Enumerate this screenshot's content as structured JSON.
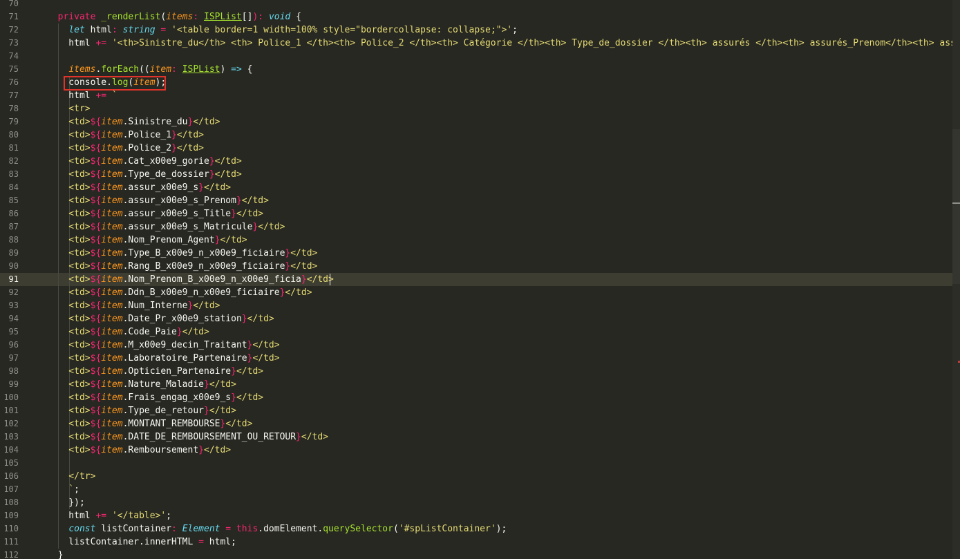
{
  "editor": {
    "active_line": 91,
    "lines": [
      {
        "n": 70,
        "tokens": []
      },
      {
        "n": 71,
        "tokens": [
          [
            "kw",
            "  private "
          ],
          [
            "fn",
            "_renderList"
          ],
          [
            "pl",
            "("
          ],
          [
            "pa",
            "items"
          ],
          [
            "kw",
            ": "
          ],
          [
            "tp",
            "ISPList"
          ],
          [
            "pl",
            "[]"
          ],
          [
            "kw",
            ")"
          ],
          [
            "kw",
            ": "
          ],
          [
            "st",
            "void"
          ],
          [
            "pl",
            " {"
          ]
        ]
      },
      {
        "n": 72,
        "tokens": [
          [
            "pl",
            "    "
          ],
          [
            "st",
            "let"
          ],
          [
            "pl",
            " html"
          ],
          [
            "kw",
            ": "
          ],
          [
            "st",
            "string"
          ],
          [
            "op",
            " = "
          ],
          [
            "s",
            "'<table border=1 width=100% style=\"bordercollapse: collapse;\">'"
          ],
          [
            "pl",
            ";"
          ]
        ]
      },
      {
        "n": 73,
        "tokens": [
          [
            "pl",
            "    html "
          ],
          [
            "op",
            "+="
          ],
          [
            "pl",
            " "
          ],
          [
            "s",
            "'<th>Sinistre_du</th> <th> Police_1 </th><th> Police_2 </th><th> Catégorie </th><th> Type_de_dossier </th><th> assurés </th><th> assurés_Prenom</th><th> assurés_"
          ]
        ]
      },
      {
        "n": 74,
        "tokens": []
      },
      {
        "n": 75,
        "tokens": [
          [
            "pl",
            "    "
          ],
          [
            "pa",
            "items"
          ],
          [
            "pl",
            "."
          ],
          [
            "fn",
            "forEach"
          ],
          [
            "pl",
            "(("
          ],
          [
            "pa",
            "item"
          ],
          [
            "kw",
            ": "
          ],
          [
            "tp",
            "ISPList"
          ],
          [
            "pl",
            ") "
          ],
          [
            "st",
            "=>"
          ],
          [
            "pl",
            " {"
          ]
        ]
      },
      {
        "n": 76,
        "tokens": [
          [
            "pl",
            "    console."
          ],
          [
            "fn",
            "log"
          ],
          [
            "pl",
            "("
          ],
          [
            "pa",
            "item"
          ],
          [
            "pl",
            ");"
          ]
        ]
      },
      {
        "n": 77,
        "tokens": [
          [
            "pl",
            "    html "
          ],
          [
            "op",
            "+="
          ],
          [
            "pl",
            " "
          ],
          [
            "s",
            "`"
          ]
        ]
      },
      {
        "n": 78,
        "tokens": [
          [
            "s",
            "    <tr>"
          ]
        ]
      },
      {
        "n": 79,
        "tokens": [
          [
            "s",
            "    <td>"
          ],
          [
            "kw",
            "${"
          ],
          [
            "pa",
            "item"
          ],
          [
            "pl",
            ".Sinistre_du"
          ],
          [
            "kw",
            "}"
          ],
          [
            "s",
            "</td>"
          ]
        ]
      },
      {
        "n": 80,
        "tokens": [
          [
            "s",
            "    <td>"
          ],
          [
            "kw",
            "${"
          ],
          [
            "pa",
            "item"
          ],
          [
            "pl",
            ".Police_1"
          ],
          [
            "kw",
            "}"
          ],
          [
            "s",
            "</td>"
          ]
        ]
      },
      {
        "n": 81,
        "tokens": [
          [
            "s",
            "    <td>"
          ],
          [
            "kw",
            "${"
          ],
          [
            "pa",
            "item"
          ],
          [
            "pl",
            ".Police_2"
          ],
          [
            "kw",
            "}"
          ],
          [
            "s",
            "</td>"
          ]
        ]
      },
      {
        "n": 82,
        "tokens": [
          [
            "s",
            "    <td>"
          ],
          [
            "kw",
            "${"
          ],
          [
            "pa",
            "item"
          ],
          [
            "pl",
            ".Cat_x00e9_gorie"
          ],
          [
            "kw",
            "}"
          ],
          [
            "s",
            "</td>"
          ]
        ]
      },
      {
        "n": 83,
        "tokens": [
          [
            "s",
            "    <td>"
          ],
          [
            "kw",
            "${"
          ],
          [
            "pa",
            "item"
          ],
          [
            "pl",
            ".Type_de_dossier"
          ],
          [
            "kw",
            "}"
          ],
          [
            "s",
            "</td>"
          ]
        ]
      },
      {
        "n": 84,
        "tokens": [
          [
            "s",
            "    <td>"
          ],
          [
            "kw",
            "${"
          ],
          [
            "pa",
            "item"
          ],
          [
            "pl",
            ".assur_x00e9_s"
          ],
          [
            "kw",
            "}"
          ],
          [
            "s",
            "</td>"
          ]
        ]
      },
      {
        "n": 85,
        "tokens": [
          [
            "s",
            "    <td>"
          ],
          [
            "kw",
            "${"
          ],
          [
            "pa",
            "item"
          ],
          [
            "pl",
            ".assur_x00e9_s_Prenom"
          ],
          [
            "kw",
            "}"
          ],
          [
            "s",
            "</td>"
          ]
        ]
      },
      {
        "n": 86,
        "tokens": [
          [
            "s",
            "    <td>"
          ],
          [
            "kw",
            "${"
          ],
          [
            "pa",
            "item"
          ],
          [
            "pl",
            ".assur_x00e9_s_Title"
          ],
          [
            "kw",
            "}"
          ],
          [
            "s",
            "</td>"
          ]
        ]
      },
      {
        "n": 87,
        "tokens": [
          [
            "s",
            "    <td>"
          ],
          [
            "kw",
            "${"
          ],
          [
            "pa",
            "item"
          ],
          [
            "pl",
            ".assur_x00e9_s_Matricule"
          ],
          [
            "kw",
            "}"
          ],
          [
            "s",
            "</td>"
          ]
        ]
      },
      {
        "n": 88,
        "tokens": [
          [
            "s",
            "    <td>"
          ],
          [
            "kw",
            "${"
          ],
          [
            "pa",
            "item"
          ],
          [
            "pl",
            ".Nom_Prenom_Agent"
          ],
          [
            "kw",
            "}"
          ],
          [
            "s",
            "</td>"
          ]
        ]
      },
      {
        "n": 89,
        "tokens": [
          [
            "s",
            "    <td>"
          ],
          [
            "kw",
            "${"
          ],
          [
            "pa",
            "item"
          ],
          [
            "pl",
            ".Type_B_x00e9_n_x00e9_ficiaire"
          ],
          [
            "kw",
            "}"
          ],
          [
            "s",
            "</td>"
          ]
        ]
      },
      {
        "n": 90,
        "tokens": [
          [
            "s",
            "    <td>"
          ],
          [
            "kw",
            "${"
          ],
          [
            "pa",
            "item"
          ],
          [
            "pl",
            ".Rang_B_x00e9_n_x00e9_ficiaire"
          ],
          [
            "kw",
            "}"
          ],
          [
            "s",
            "</td>"
          ]
        ]
      },
      {
        "n": 91,
        "tokens": [
          [
            "s",
            "    <td>"
          ],
          [
            "kw",
            "${"
          ],
          [
            "pa",
            "item"
          ],
          [
            "pl",
            ".Nom_Prenom_B_x00e9_n_x00e9_ficia"
          ],
          [
            "kw",
            "}"
          ],
          [
            "s",
            "</td>"
          ]
        ]
      },
      {
        "n": 92,
        "tokens": [
          [
            "s",
            "    <td>"
          ],
          [
            "kw",
            "${"
          ],
          [
            "pa",
            "item"
          ],
          [
            "pl",
            ".Ddn_B_x00e9_n_x00e9_ficiaire"
          ],
          [
            "kw",
            "}"
          ],
          [
            "s",
            "</td>"
          ]
        ]
      },
      {
        "n": 93,
        "tokens": [
          [
            "s",
            "    <td>"
          ],
          [
            "kw",
            "${"
          ],
          [
            "pa",
            "item"
          ],
          [
            "pl",
            ".Num_Interne"
          ],
          [
            "kw",
            "}"
          ],
          [
            "s",
            "</td>"
          ]
        ]
      },
      {
        "n": 94,
        "tokens": [
          [
            "s",
            "    <td>"
          ],
          [
            "kw",
            "${"
          ],
          [
            "pa",
            "item"
          ],
          [
            "pl",
            ".Date_Pr_x00e9_station"
          ],
          [
            "kw",
            "}"
          ],
          [
            "s",
            "</td>"
          ]
        ]
      },
      {
        "n": 95,
        "tokens": [
          [
            "s",
            "    <td>"
          ],
          [
            "kw",
            "${"
          ],
          [
            "pa",
            "item"
          ],
          [
            "pl",
            ".Code_Paie"
          ],
          [
            "kw",
            "}"
          ],
          [
            "s",
            "</td>"
          ]
        ]
      },
      {
        "n": 96,
        "tokens": [
          [
            "s",
            "    <td>"
          ],
          [
            "kw",
            "${"
          ],
          [
            "pa",
            "item"
          ],
          [
            "pl",
            ".M_x00e9_decin_Traitant"
          ],
          [
            "kw",
            "}"
          ],
          [
            "s",
            "</td>"
          ]
        ]
      },
      {
        "n": 97,
        "tokens": [
          [
            "s",
            "    <td>"
          ],
          [
            "kw",
            "${"
          ],
          [
            "pa",
            "item"
          ],
          [
            "pl",
            ".Laboratoire_Partenaire"
          ],
          [
            "kw",
            "}"
          ],
          [
            "s",
            "</td>"
          ]
        ]
      },
      {
        "n": 98,
        "tokens": [
          [
            "s",
            "    <td>"
          ],
          [
            "kw",
            "${"
          ],
          [
            "pa",
            "item"
          ],
          [
            "pl",
            ".Opticien_Partenaire"
          ],
          [
            "kw",
            "}"
          ],
          [
            "s",
            "</td>"
          ]
        ]
      },
      {
        "n": 99,
        "tokens": [
          [
            "s",
            "    <td>"
          ],
          [
            "kw",
            "${"
          ],
          [
            "pa",
            "item"
          ],
          [
            "pl",
            ".Nature_Maladie"
          ],
          [
            "kw",
            "}"
          ],
          [
            "s",
            "</td>"
          ]
        ]
      },
      {
        "n": 100,
        "tokens": [
          [
            "s",
            "    <td>"
          ],
          [
            "kw",
            "${"
          ],
          [
            "pa",
            "item"
          ],
          [
            "pl",
            ".Frais_engag_x00e9_s"
          ],
          [
            "kw",
            "}"
          ],
          [
            "s",
            "</td>"
          ]
        ]
      },
      {
        "n": 101,
        "tokens": [
          [
            "s",
            "    <td>"
          ],
          [
            "kw",
            "${"
          ],
          [
            "pa",
            "item"
          ],
          [
            "pl",
            ".Type_de_retour"
          ],
          [
            "kw",
            "}"
          ],
          [
            "s",
            "</td>"
          ]
        ]
      },
      {
        "n": 102,
        "tokens": [
          [
            "s",
            "    <td>"
          ],
          [
            "kw",
            "${"
          ],
          [
            "pa",
            "item"
          ],
          [
            "pl",
            ".MONTANT_REMBOURSE"
          ],
          [
            "kw",
            "}"
          ],
          [
            "s",
            "</td>"
          ]
        ]
      },
      {
        "n": 103,
        "tokens": [
          [
            "s",
            "    <td>"
          ],
          [
            "kw",
            "${"
          ],
          [
            "pa",
            "item"
          ],
          [
            "pl",
            ".DATE_DE_REMBOURSEMENT_OU_RETOUR"
          ],
          [
            "kw",
            "}"
          ],
          [
            "s",
            "</td>"
          ]
        ]
      },
      {
        "n": 104,
        "tokens": [
          [
            "s",
            "    <td>"
          ],
          [
            "kw",
            "${"
          ],
          [
            "pa",
            "item"
          ],
          [
            "pl",
            ".Remboursement"
          ],
          [
            "kw",
            "}"
          ],
          [
            "s",
            "</td>"
          ]
        ]
      },
      {
        "n": 105,
        "tokens": []
      },
      {
        "n": 106,
        "tokens": [
          [
            "s",
            "    </tr>"
          ]
        ]
      },
      {
        "n": 107,
        "tokens": [
          [
            "s",
            "    `"
          ],
          [
            "pl",
            ";"
          ]
        ]
      },
      {
        "n": 108,
        "tokens": [
          [
            "pl",
            "    });"
          ]
        ]
      },
      {
        "n": 109,
        "tokens": [
          [
            "pl",
            "    html "
          ],
          [
            "op",
            "+="
          ],
          [
            "pl",
            " "
          ],
          [
            "s",
            "'</table>'"
          ],
          [
            "pl",
            ";"
          ]
        ]
      },
      {
        "n": 110,
        "tokens": [
          [
            "pl",
            "    "
          ],
          [
            "st",
            "const"
          ],
          [
            "pl",
            " listContainer"
          ],
          [
            "kw",
            ": "
          ],
          [
            "st",
            "Element"
          ],
          [
            "op",
            " = "
          ],
          [
            "kw",
            "this"
          ],
          [
            "pl",
            ".domElement."
          ],
          [
            "fn",
            "querySelector"
          ],
          [
            "pl",
            "("
          ],
          [
            "s",
            "'#spListContainer'"
          ],
          [
            "pl",
            ");"
          ]
        ]
      },
      {
        "n": 111,
        "tokens": [
          [
            "pl",
            "    listContainer.innerHTML "
          ],
          [
            "op",
            "="
          ],
          [
            "pl",
            " html;"
          ]
        ]
      },
      {
        "n": 112,
        "tokens": [
          [
            "pl",
            "  }"
          ]
        ]
      }
    ]
  },
  "colors": {
    "background": "#272822",
    "keyword": "#f92672",
    "function": "#a6e22e",
    "string": "#e6db74",
    "storage": "#66d9ef",
    "parameter": "#fd971f",
    "annotation_box": "#e0332a"
  }
}
